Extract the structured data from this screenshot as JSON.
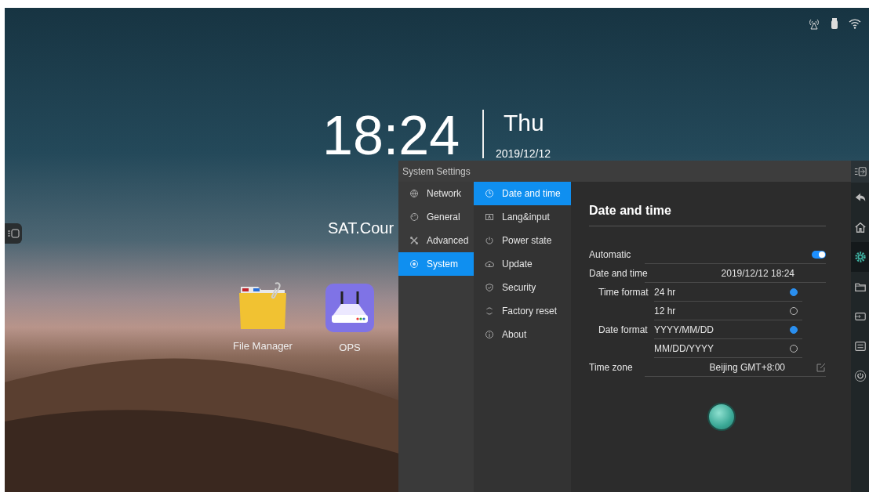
{
  "clock": {
    "time": "18:24",
    "weekday": "Thu",
    "date": "2019/12/12"
  },
  "desktop_label": "SAT.Cour",
  "apps": [
    {
      "label": "File Manager",
      "kind": "folder"
    },
    {
      "label": "OPS",
      "kind": "router"
    }
  ],
  "settings": {
    "title": "System Settings",
    "categories": [
      {
        "label": "Network",
        "selected": false
      },
      {
        "label": "General",
        "selected": false
      },
      {
        "label": "Advanced",
        "selected": false
      },
      {
        "label": "System",
        "selected": true
      }
    ],
    "subitems": [
      {
        "label": "Date and time",
        "selected": true
      },
      {
        "label": "Lang&input",
        "selected": false
      },
      {
        "label": "Power state",
        "selected": false
      },
      {
        "label": "Update",
        "selected": false
      },
      {
        "label": "Security",
        "selected": false
      },
      {
        "label": "Factory reset",
        "selected": false
      },
      {
        "label": "About",
        "selected": false
      }
    ],
    "panel": {
      "heading": "Date and time",
      "automatic": {
        "label": "Automatic",
        "on": true
      },
      "date_time": {
        "label": "Date and time",
        "value": "2019/12/12 18:24"
      },
      "time_format": {
        "label": "Time format",
        "options": [
          {
            "label": "24 hr",
            "selected": true
          },
          {
            "label": "12 hr",
            "selected": false
          }
        ]
      },
      "date_format": {
        "label": "Date format",
        "options": [
          {
            "label": "YYYY/MM/DD",
            "selected": true
          },
          {
            "label": "MM/DD/YYYY",
            "selected": false
          }
        ]
      },
      "time_zone": {
        "label": "Time zone",
        "value": "Beijing GMT+8:00"
      }
    }
  },
  "side_toolbar": [
    {
      "selected": false
    },
    {
      "selected": false
    },
    {
      "selected": false
    },
    {
      "selected": true
    },
    {
      "selected": false
    },
    {
      "selected": false
    },
    {
      "selected": false
    },
    {
      "selected": false
    }
  ]
}
